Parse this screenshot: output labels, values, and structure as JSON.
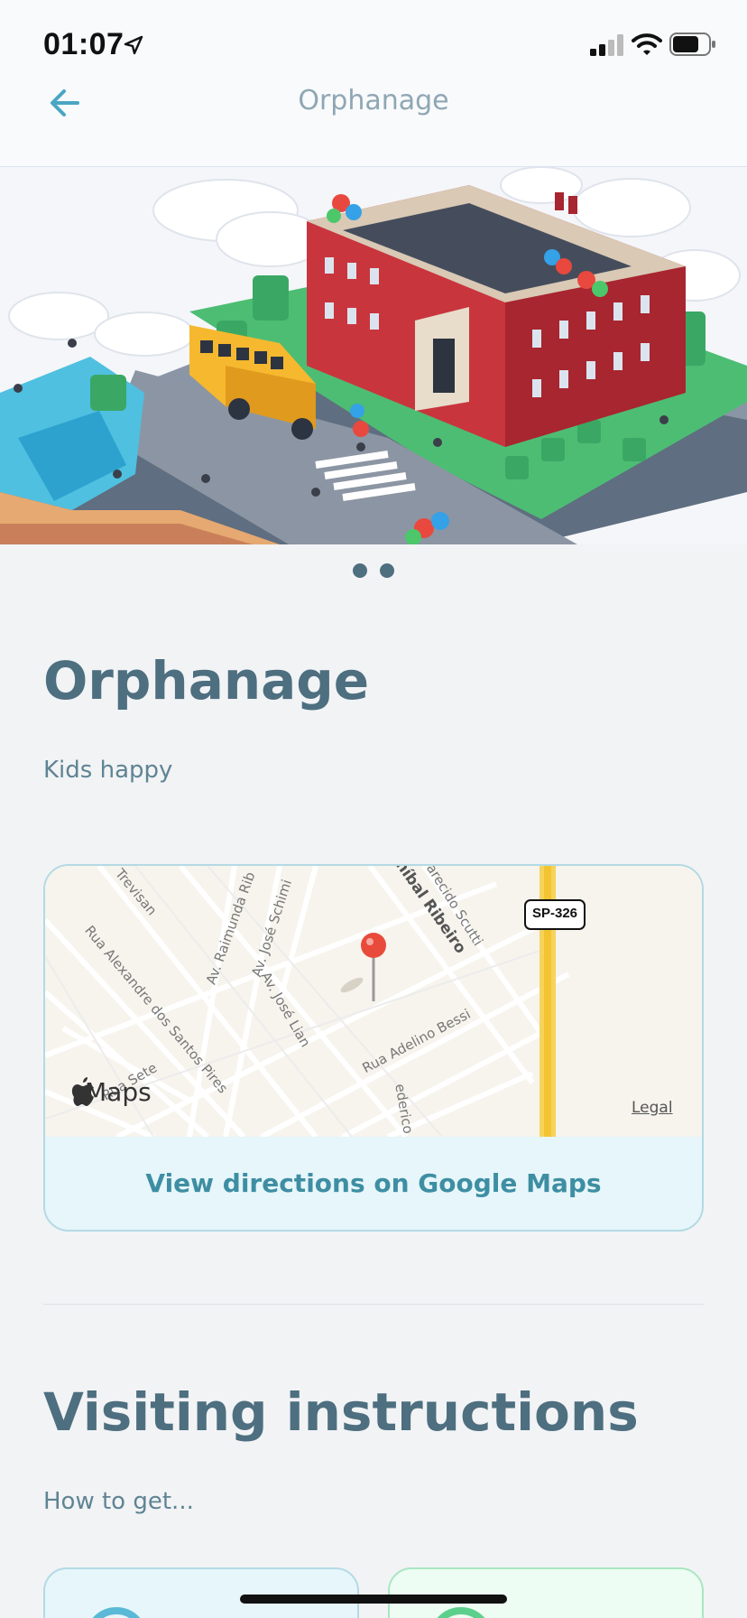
{
  "status_bar": {
    "time": "01:07",
    "icons": [
      "location-arrow-icon",
      "cellular-signal-icon",
      "wifi-icon",
      "battery-icon"
    ]
  },
  "header": {
    "back_icon": "arrow-left-icon",
    "title": "Orphanage"
  },
  "hero": {
    "image": "isometric school building with bus, kids and balloons",
    "page_indicator": {
      "count": 2
    }
  },
  "orphanage": {
    "name": "Orphanage",
    "description": "Kids happy"
  },
  "map": {
    "streets": [
      "Trevisan",
      "Av. Raimunda Rib",
      "Av. José Schimi",
      "Aníbal Ribeiro",
      "parecido Scutti",
      "Rua Alexandre dos Santos Pires",
      "Av. José Lian",
      "Rua Adelino Bessi",
      "Rua Sete",
      "ederico"
    ],
    "highway_shield": "SP-326",
    "brand": "Maps",
    "legal": "Legal",
    "directions_label": "View directions on Google Maps"
  },
  "instructions": {
    "title": "Visiting instructions",
    "subtitle": "How to get..."
  },
  "colors": {
    "accent": "#4d6f80",
    "link": "#3e8ea3",
    "card_blue": "#e6f6fa",
    "card_green": "#edfdf3"
  }
}
